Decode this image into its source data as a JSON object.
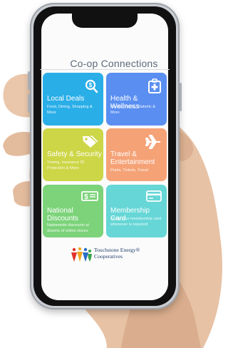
{
  "app": {
    "title": "Co-op Connections"
  },
  "tiles": [
    {
      "title": "Local Deals",
      "subtitle": "Food, Dining, Shopping & More",
      "icon": "search-tag-icon",
      "color": "#2aaee8"
    },
    {
      "title": "Health & Wellness",
      "subtitle": "Dental, Vision, Diabetic & More",
      "icon": "medical-kit-icon",
      "color": "#5a8ff1"
    },
    {
      "title": "Safety & Security",
      "subtitle": "Towing, Insurance ID Protection & More",
      "icon": "tags-icon",
      "color": "#cdd646"
    },
    {
      "title": "Travel & Entertainment",
      "subtitle": "Parks, Tickets, Travel",
      "icon": "airplane-icon",
      "color": "#f5a277"
    },
    {
      "title": "National Discounts",
      "subtitle": "Nationwide discounts at dozens of online stores",
      "icon": "dollar-bill-icon",
      "color": "#7cd37a"
    },
    {
      "title": "Membership Card",
      "subtitle": "Show your membership card whenever is required",
      "icon": "card-icon",
      "color": "#66d6d6"
    }
  ],
  "logo": {
    "line1": "Touchstone Energy®",
    "line2": "Cooperatives"
  }
}
